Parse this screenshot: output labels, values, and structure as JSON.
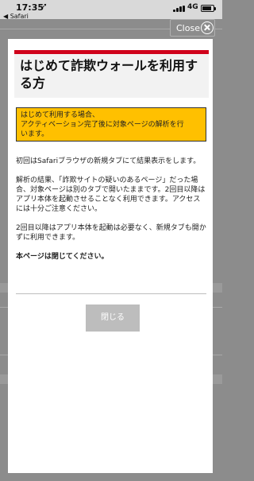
{
  "status_bar": {
    "time": "17:35",
    "back_app": "◀ Safari",
    "network": "4G"
  },
  "modal": {
    "close_label": "Close",
    "title": "はじめて詐欺ウォールを利用する方",
    "notice_lines": [
      "はじめて利用する場合、",
      "アクティベーション完了後に対象ページの解析を行",
      "います。"
    ],
    "paragraphs": [
      "初回はSafariブラウザの新規タブにて結果表示をします。",
      "解析の結果、「詐欺サイトの疑いのあるページ」だった場合、対象ページは別のタブで開いたままです。2回目以降はアプリ本体を起動させることなく利用できます。アクセスには十分ご注意ください。",
      "2回目以降はアプリ本体を起動は必要なく、新規タブも開かずに利用できます。"
    ],
    "bold_note": "本ページは閉じてください。",
    "close_page_button": "閉じる"
  },
  "colors": {
    "accent_red": "#d0021b",
    "notice_yellow": "#ffc000",
    "overlay_gray": "#8c8c8c"
  },
  "icons": {
    "close": "close-icon",
    "battery": "battery-icon",
    "signal": "signal-icon"
  }
}
